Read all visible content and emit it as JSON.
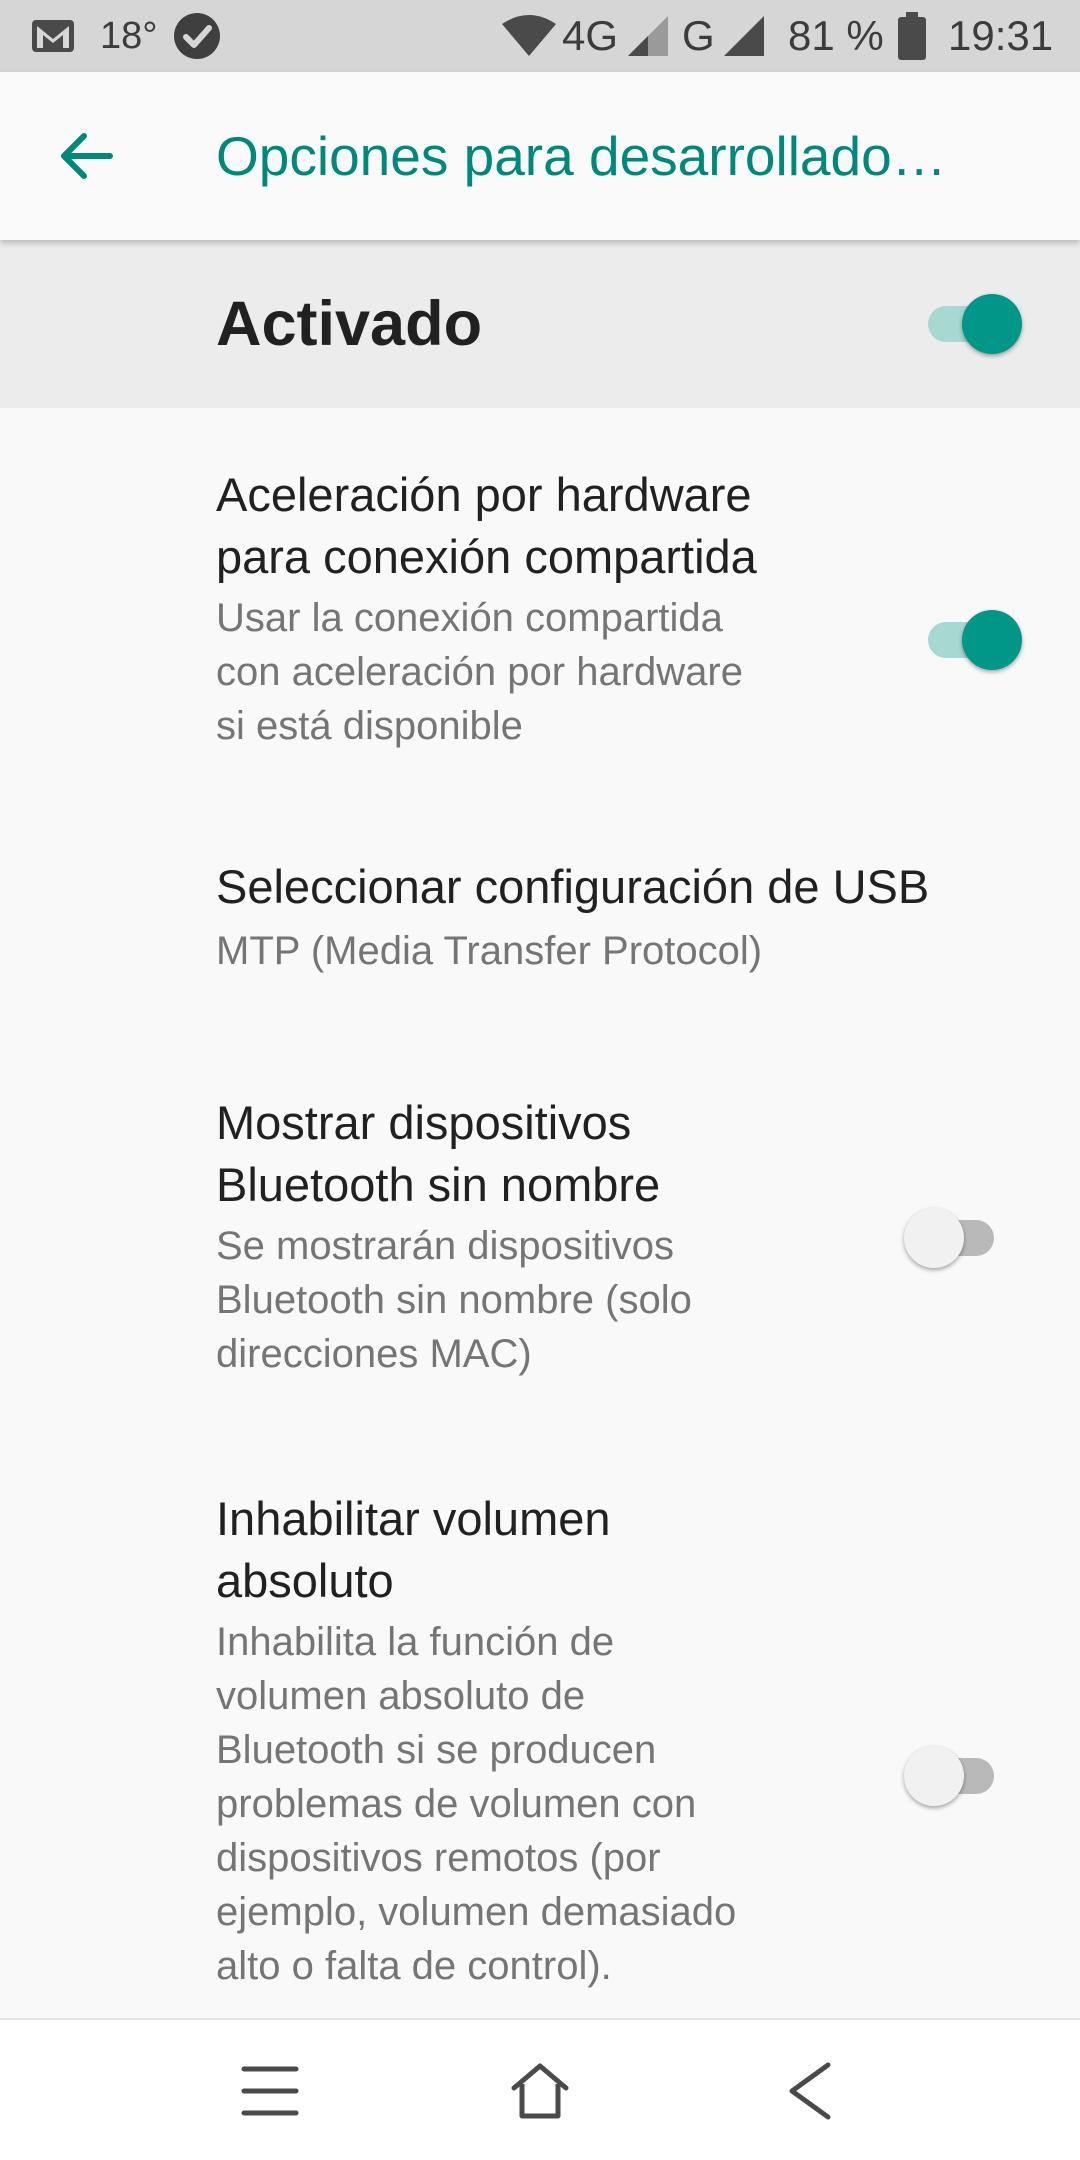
{
  "status_bar": {
    "temperature": "18°",
    "network_primary": "4G",
    "network_secondary": "G",
    "battery_percent": "81 %",
    "time": "19:31",
    "icons": [
      "gmail-icon",
      "check-circle-icon",
      "wifi-icon",
      "signal-icon",
      "signal-icon",
      "battery-icon"
    ]
  },
  "app_bar": {
    "title": "Opciones para desarrollado…",
    "back_icon": "arrow-back-icon"
  },
  "master_switch": {
    "label": "Activado",
    "checked": true
  },
  "settings": [
    {
      "title_line1": "Aceleración por hardware",
      "title_line2": "para conexión compartida",
      "summary_line1": "Usar la conexión compartida",
      "summary_line2": "con aceleración por hardware",
      "summary_line3": "si está disponible",
      "checked": true
    },
    {
      "title_line1": "Seleccionar configuración de USB",
      "summary_line1": "MTP (Media Transfer Protocol)"
    },
    {
      "title_line1": "Mostrar dispositivos",
      "title_line2": "Bluetooth sin nombre",
      "summary_line1": "Se mostrarán dispositivos",
      "summary_line2": "Bluetooth sin nombre (solo",
      "summary_line3": "direcciones MAC)",
      "checked": false
    },
    {
      "title_line1": "Inhabilitar volumen",
      "title_line2": "absoluto",
      "summary_line1": "Inhabilita la función de",
      "summary_line2": "volumen absoluto de",
      "summary_line3": "Bluetooth si se producen",
      "summary_line4": "problemas de volumen con",
      "summary_line5": "dispositivos remotos (por",
      "summary_line6": "ejemplo, volumen demasiado",
      "summary_line7": "alto o falta de control).",
      "checked": false
    }
  ],
  "nav_bar": {
    "icons": [
      "menu-icon",
      "home-icon",
      "back-icon"
    ]
  },
  "colors": {
    "accent": "#00897b",
    "switch_on": "#009688",
    "switch_track_on": "#a8d8d2"
  }
}
